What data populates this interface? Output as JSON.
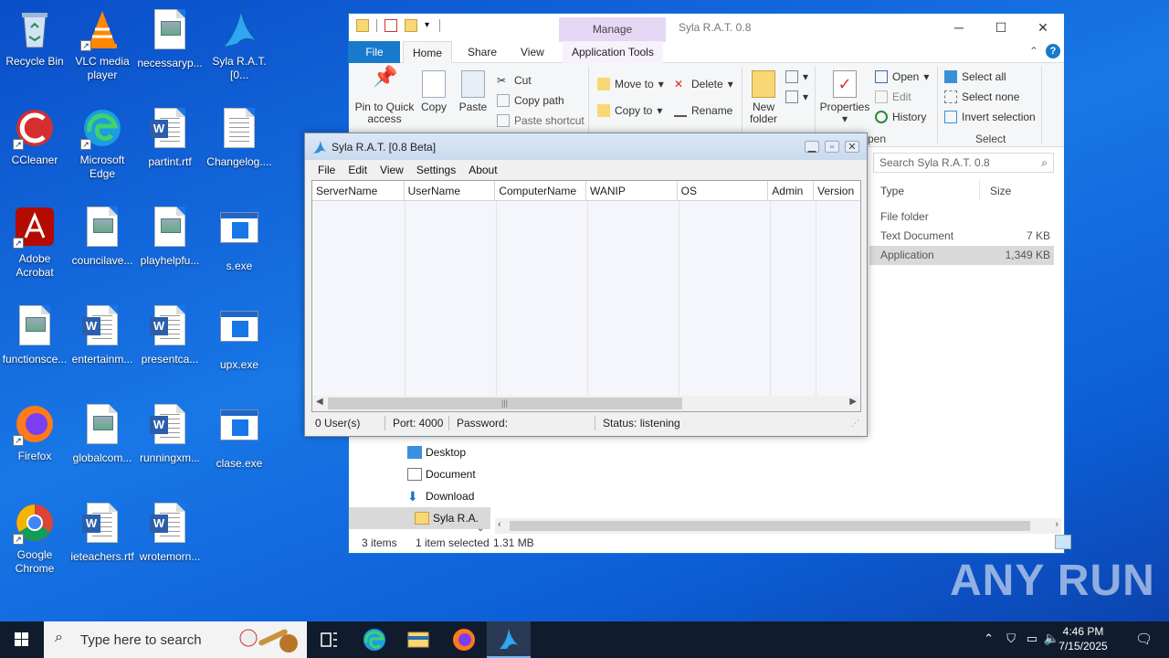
{
  "desktop": {
    "icons": [
      {
        "label": "Recycle Bin"
      },
      {
        "label": "VLC media player"
      },
      {
        "label": "necessaryp..."
      },
      {
        "label": "Syla R.A.T.[0..."
      },
      {
        "label": "CCleaner"
      },
      {
        "label": "Microsoft Edge"
      },
      {
        "label": "partint.rtf"
      },
      {
        "label": "Changelog...."
      },
      {
        "label": "Adobe Acrobat"
      },
      {
        "label": "councilave..."
      },
      {
        "label": "playhelpfu..."
      },
      {
        "label": "s.exe"
      },
      {
        "label": "functionsce..."
      },
      {
        "label": "entertainm..."
      },
      {
        "label": "presentca..."
      },
      {
        "label": "upx.exe"
      },
      {
        "label": "Firefox"
      },
      {
        "label": "globalcom..."
      },
      {
        "label": "runningxm..."
      },
      {
        "label": "clase.exe"
      },
      {
        "label": "Google Chrome"
      },
      {
        "label": "ieteachers.rtf"
      },
      {
        "label": "wrotemorn..."
      }
    ]
  },
  "explorer": {
    "title": "Syla R.A.T. 0.8",
    "manage_tab": "Manage",
    "tabs": {
      "file": "File",
      "home": "Home",
      "share": "Share",
      "view": "View",
      "app_tools": "Application Tools"
    },
    "ribbon": {
      "pin": "Pin to Quick access",
      "copy": "Copy",
      "paste": "Paste",
      "cut": "Cut",
      "copy_path": "Copy path",
      "paste_shortcut": "Paste shortcut",
      "move_to": "Move to",
      "copy_to": "Copy to",
      "delete": "Delete",
      "rename": "Rename",
      "new_folder": "New folder",
      "properties": "Properties",
      "open": "Open",
      "edit": "Edit",
      "history": "History",
      "open_group": "Open",
      "select_all": "Select all",
      "select_none": "Select none",
      "invert_selection": "Invert selection",
      "select_group": "Select"
    },
    "search_placeholder": "Search Syla R.A.T. 0.8",
    "columns": {
      "type": "Type",
      "size": "Size"
    },
    "rows": [
      {
        "type": "File folder",
        "size": ""
      },
      {
        "type": "Text Document",
        "size": "7 KB"
      },
      {
        "type": "Application",
        "size": "1,349 KB"
      }
    ],
    "nav": [
      {
        "label": "Desktop"
      },
      {
        "label": "Document"
      },
      {
        "label": "Download"
      },
      {
        "label": "Syla R.A."
      }
    ],
    "status": {
      "items": "3 items",
      "selected": "1 item selected",
      "size": "1.31 MB"
    }
  },
  "rat": {
    "title": "Syla R.A.T. [0.8 Beta]",
    "menu": [
      "File",
      "Edit",
      "View",
      "Settings",
      "About"
    ],
    "columns": [
      "ServerName",
      "UserName",
      "ComputerName",
      "WANIP",
      "OS",
      "Admin",
      "Version"
    ],
    "status": {
      "users": "0 User(s)",
      "port": "Port: 4000",
      "password": "Password:",
      "state": "Status: listening"
    }
  },
  "taskbar": {
    "search_placeholder": "Type here to search",
    "time": "4:46 PM",
    "date": "7/15/2025"
  },
  "watermark": "ANY RUN",
  "colors": {
    "accent": "#1979ca",
    "manage": "#e6d7f5",
    "desktop": "#1877e6"
  }
}
